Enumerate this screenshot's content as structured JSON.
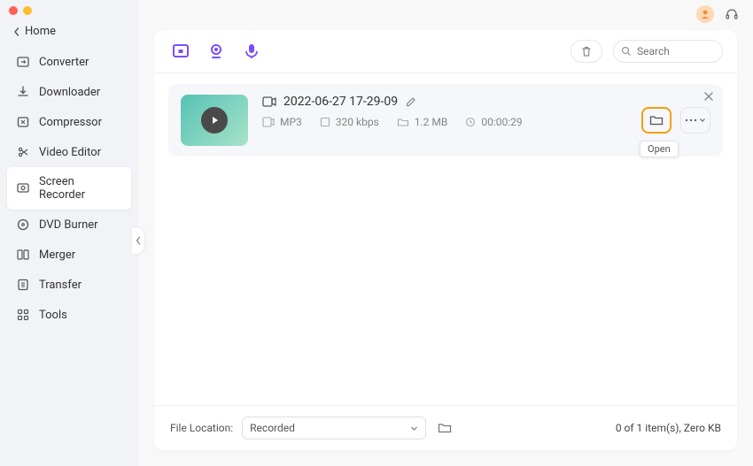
{
  "sidebar": {
    "home": "Home",
    "items": [
      {
        "label": "Converter"
      },
      {
        "label": "Downloader"
      },
      {
        "label": "Compressor"
      },
      {
        "label": "Video Editor"
      },
      {
        "label": "Screen Recorder"
      },
      {
        "label": "DVD Burner"
      },
      {
        "label": "Merger"
      },
      {
        "label": "Transfer"
      },
      {
        "label": "Tools"
      }
    ]
  },
  "toolbar": {
    "search_placeholder": "Search"
  },
  "file": {
    "title": "2022-06-27 17-29-09",
    "format": "MP3",
    "bitrate": "320 kbps",
    "size": "1.2 MB",
    "duration": "00:00:29",
    "open_tooltip": "Open"
  },
  "footer": {
    "location_label": "File Location:",
    "location_value": "Recorded",
    "status": "0 of 1 item(s), Zero KB"
  }
}
